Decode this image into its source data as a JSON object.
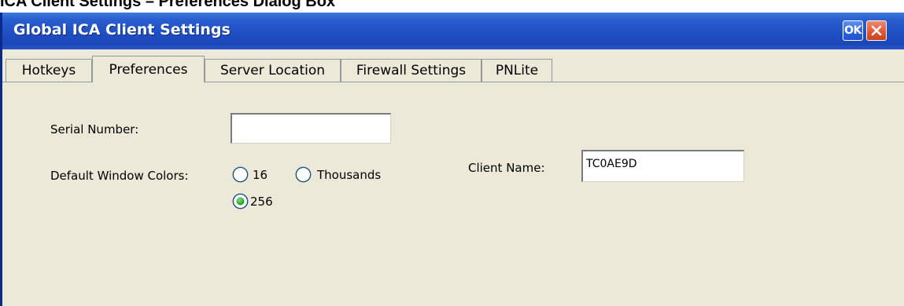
{
  "document": {
    "caption": "ICA Client Settings – Preferences Dialog Box"
  },
  "window": {
    "title": "Global ICA Client Settings",
    "ok_label": "OK",
    "close_icon": "close-icon",
    "colors": {
      "titlebar": "#1f4fc4",
      "body": "#ece9d8",
      "close": "#e05a3a"
    }
  },
  "tabs": [
    {
      "label": "Hotkeys",
      "selected": false
    },
    {
      "label": "Preferences",
      "selected": true
    },
    {
      "label": "Server Location",
      "selected": false
    },
    {
      "label": "Firewall Settings",
      "selected": false
    },
    {
      "label": "PNLite",
      "selected": false
    }
  ],
  "preferences": {
    "serial_number": {
      "label": "Serial Number:",
      "value": ""
    },
    "window_colors": {
      "label": "Default Window Colors:",
      "options": [
        {
          "label": "16",
          "selected": false
        },
        {
          "label": "Thousands",
          "selected": false
        },
        {
          "label": "256",
          "selected": true
        }
      ]
    },
    "client_name": {
      "label": "Client Name:",
      "value": "TC0AE9D"
    }
  }
}
